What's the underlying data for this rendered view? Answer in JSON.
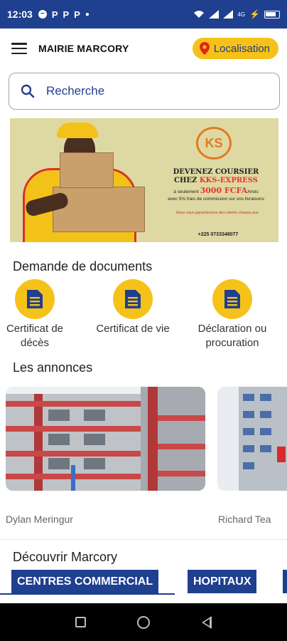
{
  "status_bar": {
    "time": "12:03",
    "notification_letters": [
      "P",
      "P",
      "P"
    ],
    "network": "4G"
  },
  "app_bar": {
    "title": "MAIRIE MARCORY",
    "location_button": "Localisation"
  },
  "search": {
    "placeholder": "Recherche"
  },
  "banner": {
    "logo": "KS",
    "headline_line1": "DEVENEZ COURSIER",
    "headline_line2_prefix": "CHEZ ",
    "headline_line2_accent": "KKS-EXPRESS",
    "price_prefix": "à seulement ",
    "price": "3000 FCFA",
    "price_suffix": "/mois",
    "price_note": "avec 5% frais de commission sur vos livraisons",
    "note": "Nous vous garantissons des clients chaque jour",
    "phone": "+225 0733348077"
  },
  "documents": {
    "title": "Demande de documents",
    "items": [
      {
        "line1": "Certificat de",
        "line2": "décès",
        "icon": "document-icon"
      },
      {
        "line1": "Certificat de vie",
        "line2": "",
        "icon": "document-icon"
      },
      {
        "line1": "Déclaration ou",
        "line2": "procuration",
        "icon": "document-icon"
      }
    ]
  },
  "annonces": {
    "title": "Les annonces",
    "items": [
      {
        "author": "Dylan Meringur"
      },
      {
        "author": "Richard Tea"
      }
    ]
  },
  "decouvrir": {
    "title": "Découvrir Marcory",
    "categories": [
      "CENTRES COMMERCIAL",
      "HOPITAUX"
    ]
  },
  "colors": {
    "primary": "#1f3f8f",
    "accent": "#f6c21a"
  }
}
